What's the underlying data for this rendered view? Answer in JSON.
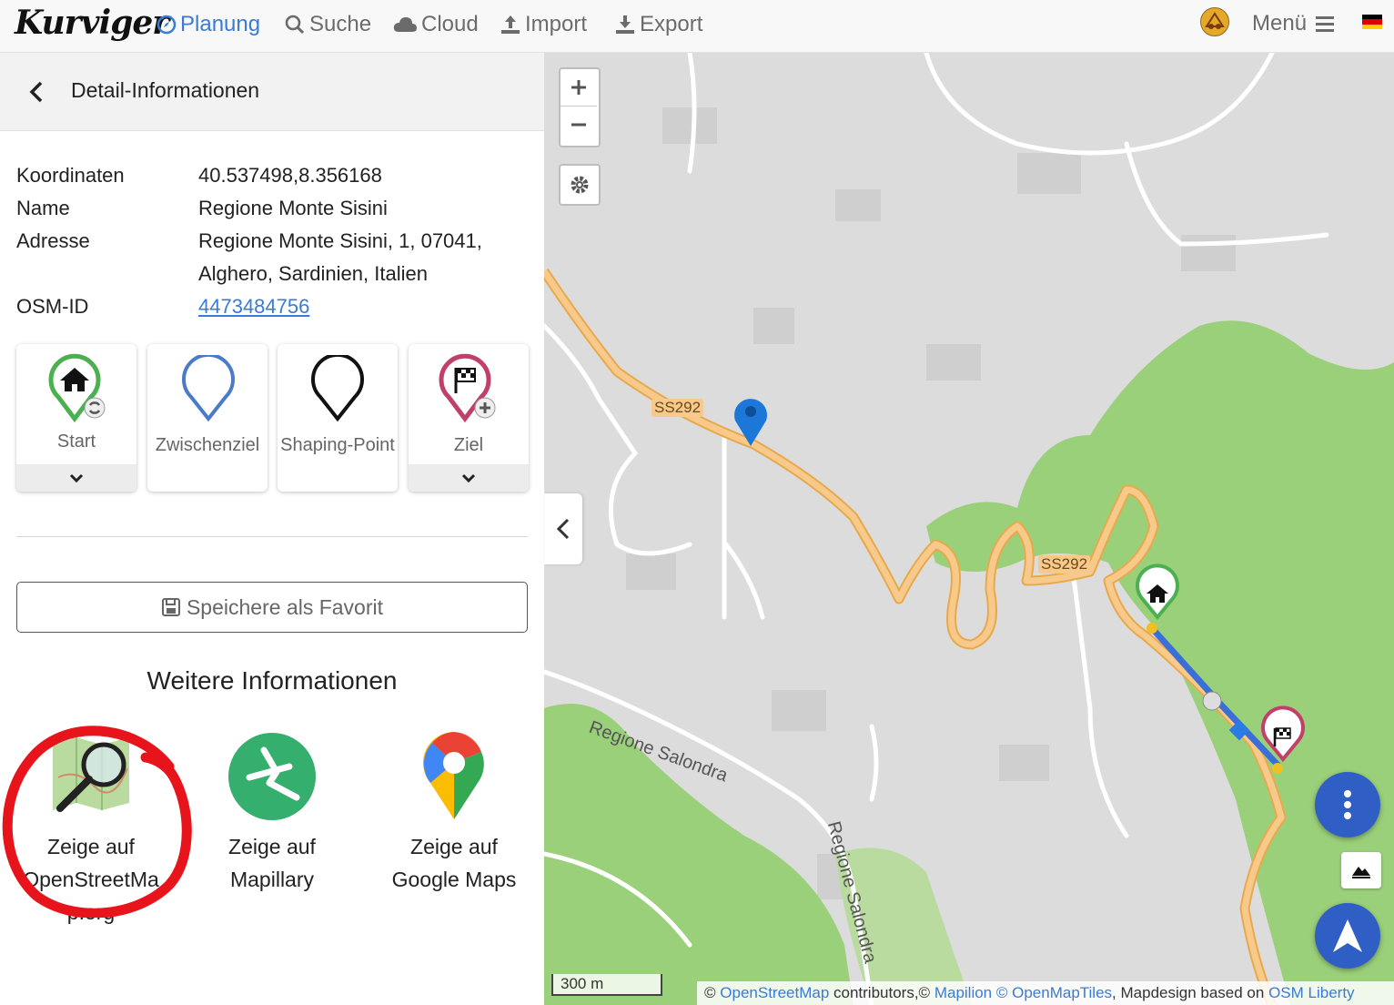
{
  "app": {
    "logo": "Kurviger"
  },
  "nav": {
    "items": [
      {
        "label": "Planung",
        "icon": "compass-icon",
        "active": true
      },
      {
        "label": "Suche",
        "icon": "search-icon"
      },
      {
        "label": "Cloud",
        "icon": "cloud-icon"
      },
      {
        "label": "Import",
        "icon": "upload-icon"
      },
      {
        "label": "Export",
        "icon": "download-icon"
      }
    ],
    "menu_label": "Menü"
  },
  "panel": {
    "title": "Detail-Informationen",
    "details": {
      "coord_label": "Koordinaten",
      "coord_value": "40.537498,8.356168",
      "name_label": "Name",
      "name_value": "Regione Monte Sisini",
      "address_label": "Adresse",
      "address_line1": "Regione Monte Sisini, 1, 07041,",
      "address_line2": "Alghero, Sardinien, Italien",
      "osm_label": "OSM-ID",
      "osm_value": "4473484756"
    },
    "waypoints": [
      {
        "label": "Start",
        "color": "#4caf50",
        "icon": "home-icon"
      },
      {
        "label": "Zwischenziel",
        "color": "#3a72c4"
      },
      {
        "label": "Shaping-Point",
        "color": "#111111"
      },
      {
        "label": "Ziel",
        "color": "#c0406a",
        "icon": "flag-icon"
      }
    ],
    "favorite_label": "Speichere als Favorit",
    "more_title": "Weitere Informationen",
    "external": [
      {
        "label": "Zeige auf OpenStreetMap.org",
        "line1": "Zeige auf",
        "line2": "OpenStreetMa",
        "line3": "p.org"
      },
      {
        "label": "Zeige auf Mapillary",
        "line1": "Zeige auf",
        "line2": "Mapillary"
      },
      {
        "label": "Zeige auf Google Maps",
        "line1": "Zeige auf",
        "line2": "Google Maps"
      }
    ]
  },
  "map": {
    "road_labels": {
      "a": "SS292",
      "b": "SS292"
    },
    "street_labels": {
      "a": "Regione Salondra",
      "b": "Regione Salondra"
    },
    "scale": "300 m",
    "attribution": {
      "prefix": "©",
      "osm": "OpenStreetMap",
      "contrib": "contributors,©",
      "mapilion": "Mapilion",
      "omt": "© OpenMapTiles",
      "design": ", Mapdesign based on",
      "liberty": "OSM Liberty"
    }
  },
  "colors": {
    "accent": "#3a7bd5",
    "fab": "#2f5fc4",
    "highlight_circle": "#e8141c",
    "road": "#f7c98a",
    "forest": "#9bd07a"
  }
}
